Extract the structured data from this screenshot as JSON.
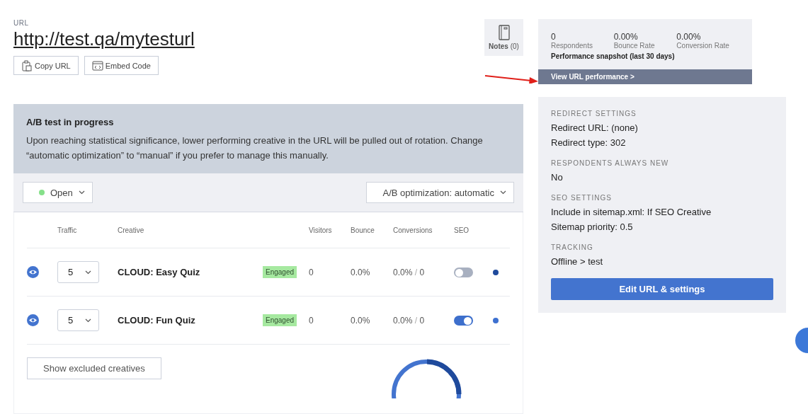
{
  "url": {
    "label": "URL",
    "link": "http://test.qa/mytesturl",
    "buttons": [
      "Copy URL",
      "Embed Code"
    ]
  },
  "notes": {
    "label": "Notes",
    "count": "(0)"
  },
  "performance": {
    "stats": [
      {
        "value": "0",
        "label": "Respondents"
      },
      {
        "value": "0.00%",
        "label": "Bounce Rate"
      },
      {
        "value": "0.00%",
        "label": "Conversion Rate"
      }
    ],
    "caption": "Performance snapshot (last 30 days)",
    "link": "View URL performance >"
  },
  "ab_test": {
    "title": "A/B test in progress",
    "text": "Upon reaching statistical significance, lower performing creative in the URL will be pulled out of rotation. Change “automatic optimization” to “manual” if you prefer to manage this manually.",
    "status": "Open",
    "optimization": "A/B optimization: automatic"
  },
  "table": {
    "columns": [
      "Traffic",
      "Creative",
      "Visitors",
      "Bounce",
      "Conversions",
      "SEO"
    ],
    "rows": [
      {
        "traffic": "5",
        "creative": "CLOUD: Easy Quiz",
        "badge": "Engaged",
        "visitors": "0",
        "bounce": "0.0%",
        "conversion_rate": "0.0%",
        "separator": "/",
        "conversions": "0",
        "seo": false,
        "color": "#1f4a9c"
      },
      {
        "traffic": "5",
        "creative": "CLOUD: Fun Quiz",
        "badge": "Engaged",
        "visitors": "0",
        "bounce": "0.0%",
        "conversion_rate": "0.0%",
        "separator": "/",
        "conversions": "0",
        "seo": true,
        "color": "#3d70d0"
      }
    ]
  },
  "show_excluded": "Show excluded creatives",
  "settings": {
    "sections": [
      {
        "heading": "REDIRECT SETTINGS",
        "lines": [
          "Redirect URL: (none)",
          "Redirect type: 302"
        ]
      },
      {
        "heading": "RESPONDENTS ALWAYS NEW",
        "lines": [
          "No"
        ]
      },
      {
        "heading": "SEO SETTINGS",
        "lines": [
          "Include in sitemap.xml: If SEO Creative",
          "Sitemap priority: 0.5"
        ]
      },
      {
        "heading": "TRACKING",
        "lines": [
          "Offline > test"
        ]
      }
    ],
    "button": "Edit URL & settings"
  }
}
